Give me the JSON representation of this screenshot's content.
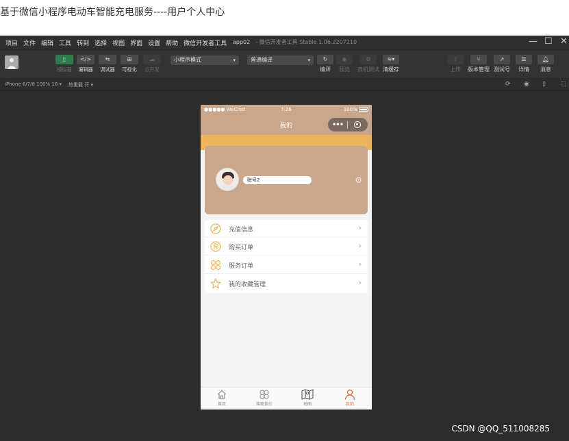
{
  "page_title": "基于微信小程序电动车智能充电服务----用户个人中心",
  "ide": {
    "menu": [
      "项目",
      "文件",
      "编辑",
      "工具",
      "转到",
      "选择",
      "视图",
      "界面",
      "设置",
      "帮助",
      "微信开发者工具"
    ],
    "app_name": "app02",
    "window_title": "- 微信开发者工具 Stable 1.06.2207210",
    "toolbar": {
      "simulator": "模拟器",
      "editor": "编辑器",
      "debugger": "调试器",
      "visual": "可视化",
      "cloud": "云开发",
      "mode_select": "小程序模式",
      "compile_select": "普通编译",
      "compile": "编译",
      "preview": "预览",
      "real_debug": "真机调试",
      "clear_cache": "清缓存",
      "upload": "上传",
      "version": "版本管理",
      "test": "测试号",
      "details": "详情",
      "messages": "消息"
    },
    "subbar": {
      "device": "iPhone 6/7/8 100% 16 ▾",
      "hot_reload": "热重载 开 ▾"
    }
  },
  "phone": {
    "status": {
      "signal": "●●●●● WeChat",
      "time": "7:26",
      "battery": "100%"
    },
    "nav_title": "我的",
    "capsule": {
      "dots": "•••"
    },
    "account": "账号2",
    "menu_items": [
      {
        "label": "充值信息",
        "icon": "compass-icon"
      },
      {
        "label": "购买订单",
        "icon": "registered-icon"
      },
      {
        "label": "服务订单",
        "icon": "grid-icon"
      },
      {
        "label": "我的收藏管理",
        "icon": "star-icon"
      }
    ],
    "tabs": [
      {
        "label": "首页",
        "icon": "home-icon"
      },
      {
        "label": "购物指引",
        "icon": "clover-icon"
      },
      {
        "label": "地图",
        "icon": "map-icon"
      },
      {
        "label": "我的",
        "icon": "user-icon",
        "active": true
      }
    ],
    "colors": {
      "header": "#c9a78c",
      "band": "#efb55c",
      "icon": "#efb55c",
      "active_tab": "#d86c3e"
    }
  },
  "watermark": "CSDN @QQ_511008285"
}
